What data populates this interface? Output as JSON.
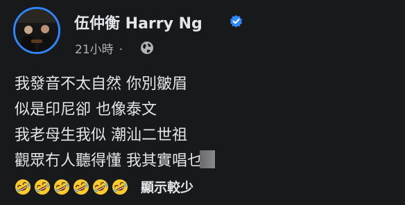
{
  "post": {
    "author": {
      "name": "伍仲衡 Harry Ng",
      "verified": true,
      "avatar_icon": "profile-photo"
    },
    "timestamp": "21小時",
    "separator": "·",
    "audience_icon": "globe-icon",
    "body_lines": [
      "我發音不太自然 你別皺眉",
      "似是印尼卻 也像泰文",
      "我老母生我似 潮汕二世祖",
      "觀眾冇人聽得懂 我其實唱乜"
    ],
    "emoji_name": "rolling-on-the-floor-laughing-emoji",
    "emoji_count": 6,
    "see_more_label": "顯示較少"
  },
  "colors": {
    "background": "#18191a",
    "primary_text": "#e4e6eb",
    "secondary_text": "#b0b3b8",
    "accent_blue": "#2d88ff",
    "emoji_yellow": "#fbcb2e"
  }
}
